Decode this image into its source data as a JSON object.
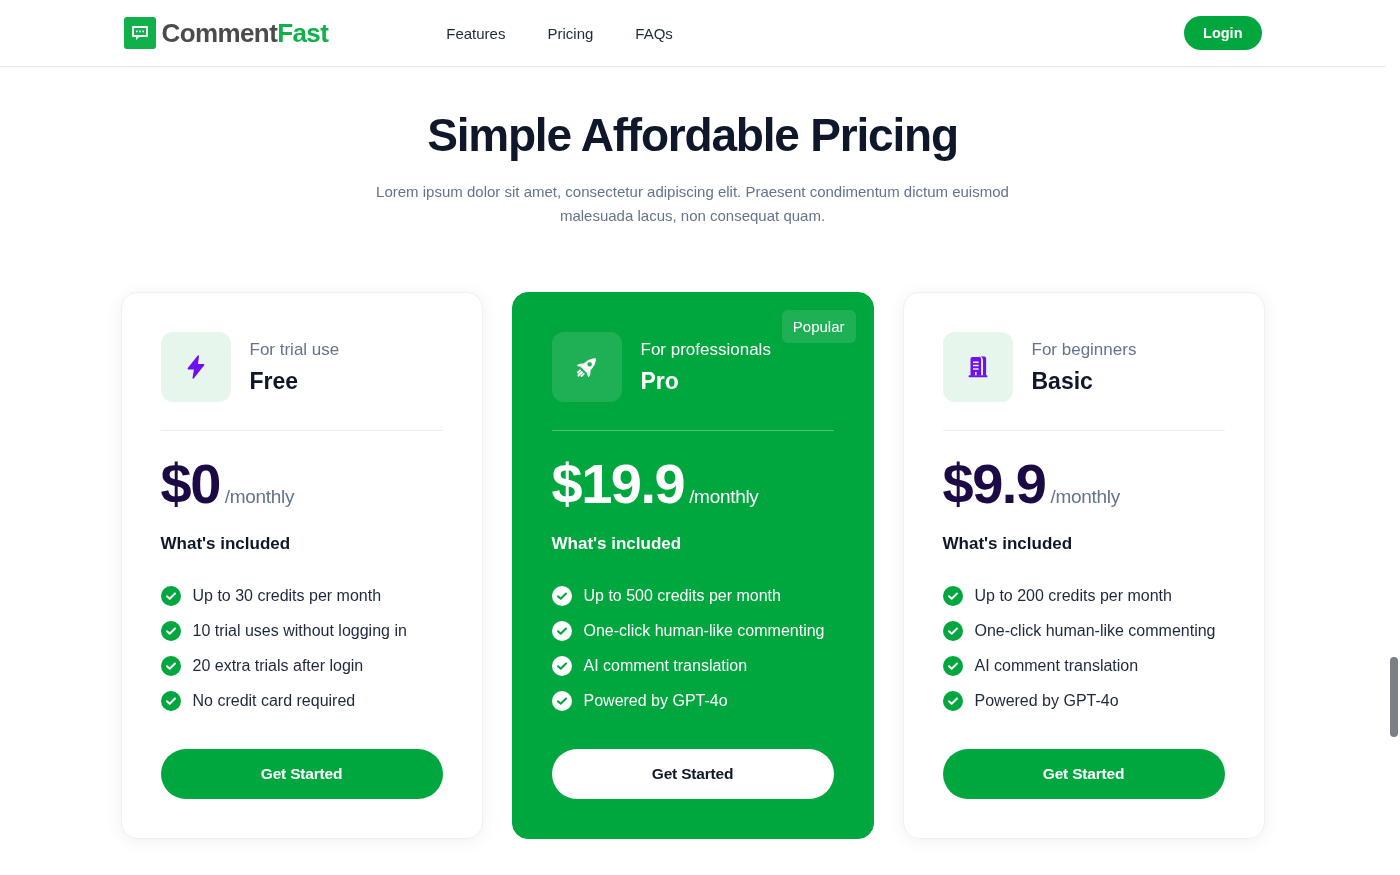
{
  "header": {
    "logo": {
      "text": "Comment",
      "accent": "Fast"
    },
    "nav": [
      "Features",
      "Pricing",
      "FAQs"
    ],
    "login_button": "Login"
  },
  "hero": {
    "title": "Simple Affordable Pricing",
    "subtitle": "Lorem ipsum dolor sit amet, consectetur adipiscing elit. Praesent condimentum dictum euismod malesuada lacus, non consequat quam."
  },
  "plans": [
    {
      "kind": "standard",
      "tagline": "For trial use",
      "name": "Free",
      "price": "$0",
      "period": "/monthly",
      "included_heading": "What's included",
      "features": [
        "Up to 30 credits per month",
        "10 trial uses without logging in",
        "20 extra trials after login",
        "No credit card required"
      ],
      "button": "Get Started"
    },
    {
      "kind": "featured",
      "badge": "Popular",
      "tagline": "For professionals",
      "name": "Pro",
      "price": "$19.9",
      "period": "/monthly",
      "included_heading": "What's included",
      "features": [
        "Up to 500 credits per month",
        "One-click human-like commenting",
        "AI comment translation",
        "Powered by GPT-4o"
      ],
      "button": "Get Started"
    },
    {
      "kind": "standard",
      "tagline": "For beginners",
      "name": "Basic",
      "price": "$9.9",
      "period": "/monthly",
      "included_heading": "What's included",
      "features": [
        "Up to 200 credits per month",
        "One-click human-like commenting",
        "AI comment translation",
        "Powered by GPT-4o"
      ],
      "button": "Get Started"
    }
  ]
}
